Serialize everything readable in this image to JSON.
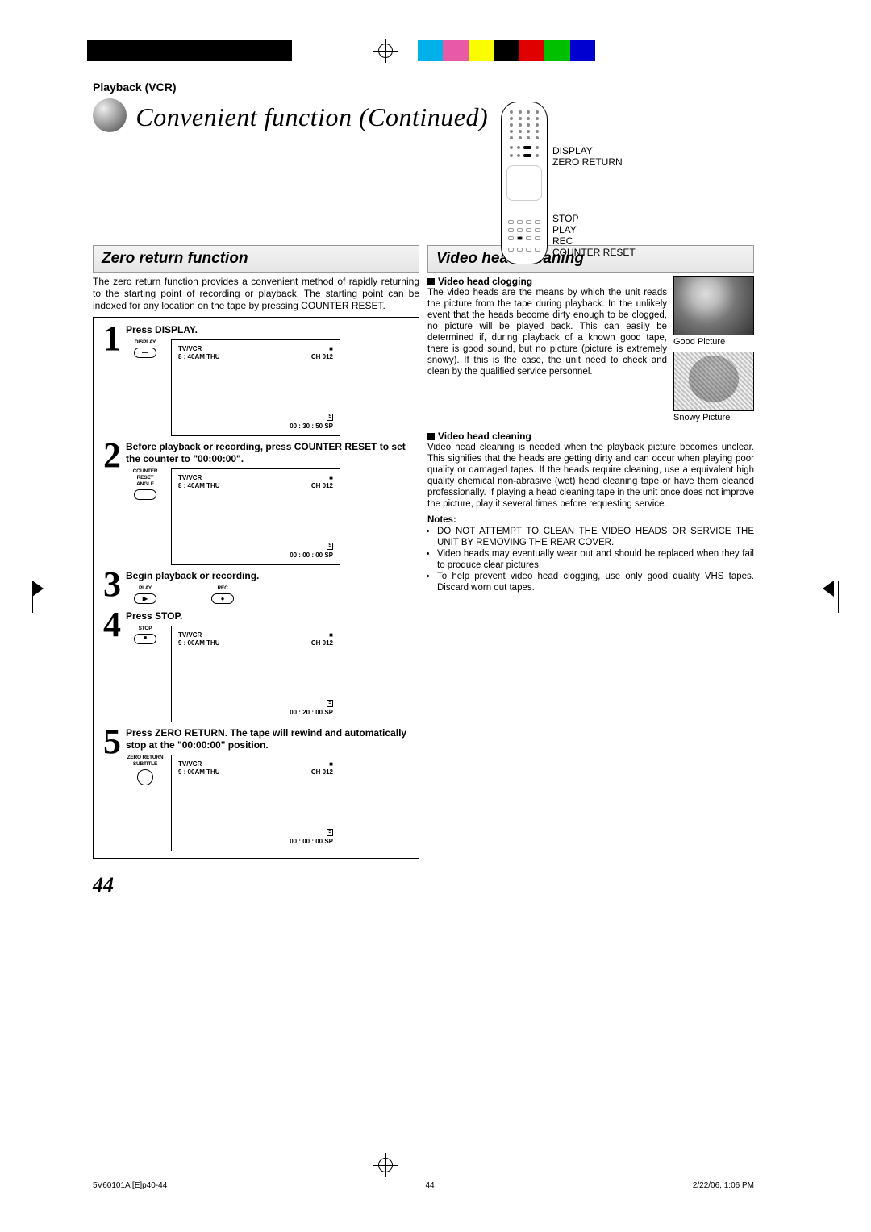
{
  "breadcrumb": "Playback (VCR)",
  "title": "Convenient function (Continued)",
  "remote_labels": {
    "l1": "DISPLAY",
    "l2": "ZERO RETURN",
    "l3": "STOP",
    "l4": "PLAY",
    "l5": "REC",
    "l6": "COUNTER RESET"
  },
  "left": {
    "header": "Zero return function",
    "intro": "The zero return function provides a convenient method of rapidly returning to the starting point of recording or playback. The starting point can be indexed for any location on the tape by pressing COUNTER RESET.",
    "steps": {
      "s1": {
        "num": "1",
        "text": "Press DISPLAY.",
        "btn_label": "DISPLAY",
        "btn_glyph": "—",
        "osd": {
          "tvvcr": "TV/VCR",
          "stop": "■",
          "time": "8 : 40AM THU",
          "ch": "CH 012",
          "stereo": "S",
          "counter": "00 : 30 : 50   SP"
        }
      },
      "s2": {
        "num": "2",
        "text": "Before playback or recording, press COUNTER RESET to set the counter to \"00:00:00\".",
        "btn_label": "COUNTER RESET\nANGLE",
        "btn_glyph": "",
        "osd": {
          "tvvcr": "TV/VCR",
          "stop": "■",
          "time": "8 : 40AM THU",
          "ch": "CH 012",
          "stereo": "S",
          "counter": "00 : 00 : 00   SP"
        }
      },
      "s3": {
        "num": "3",
        "text": "Begin playback or recording.",
        "btn1_label": "PLAY",
        "btn1_glyph": "▶",
        "btn2_label": "REC",
        "btn2_glyph": "●"
      },
      "s4": {
        "num": "4",
        "text": "Press STOP.",
        "btn_label": "STOP",
        "btn_glyph": "■",
        "osd": {
          "tvvcr": "TV/VCR",
          "stop": "■",
          "time": "9 : 00AM THU",
          "ch": "CH 012",
          "stereo": "S",
          "counter": "00 : 20 : 00   SP"
        }
      },
      "s5": {
        "num": "5",
        "text": "Press ZERO RETURN. The tape will rewind and automatically stop at the \"00:00:00\" position.",
        "btn_label": "ZERO RETURN\nSUBTITLE",
        "btn_glyph": "",
        "osd": {
          "tvvcr": "TV/VCR",
          "stop": "■",
          "time": "9 : 00AM THU",
          "ch": "CH 012",
          "stereo": "S",
          "counter": "00 : 00 : 00   SP"
        }
      }
    }
  },
  "right": {
    "header": "Video head cleaning",
    "sub1": "Video head clogging",
    "para1": "The video heads are the means by which the unit reads the picture from the tape during playback. In the unlikely event that the heads become dirty enough to be clogged, no picture will be played back. This can easily be determined if, during playback of a known good tape, there is good sound, but no picture (picture is extremely snowy). If this is the case, the unit need to check and clean by the qualified service personnel.",
    "pic_good": "Good Picture",
    "pic_snowy": "Snowy Picture",
    "sub2": "Video head cleaning",
    "para2": "Video head cleaning is needed when the playback picture becomes unclear. This signifies that the heads are getting dirty and can occur when playing poor quality or damaged tapes. If the heads require cleaning, use a equivalent high quality chemical non-abrasive (wet) head cleaning tape or have them cleaned professionally. If playing a head cleaning tape in the unit once does not improve the picture, play it several times before requesting service.",
    "notes_label": "Notes:",
    "notes": [
      "DO NOT ATTEMPT TO CLEAN THE VIDEO HEADS OR SERVICE THE UNIT BY REMOVING THE REAR COVER.",
      "Video heads may eventually wear out and should be replaced when they fail to produce clear pictures.",
      "To help prevent video head clogging, use only good quality VHS tapes. Discard worn out tapes."
    ]
  },
  "page_number": "44",
  "footer": {
    "left": "5V60101A [E]p40-44",
    "center": "44",
    "right": "2/22/06, 1:06 PM"
  }
}
